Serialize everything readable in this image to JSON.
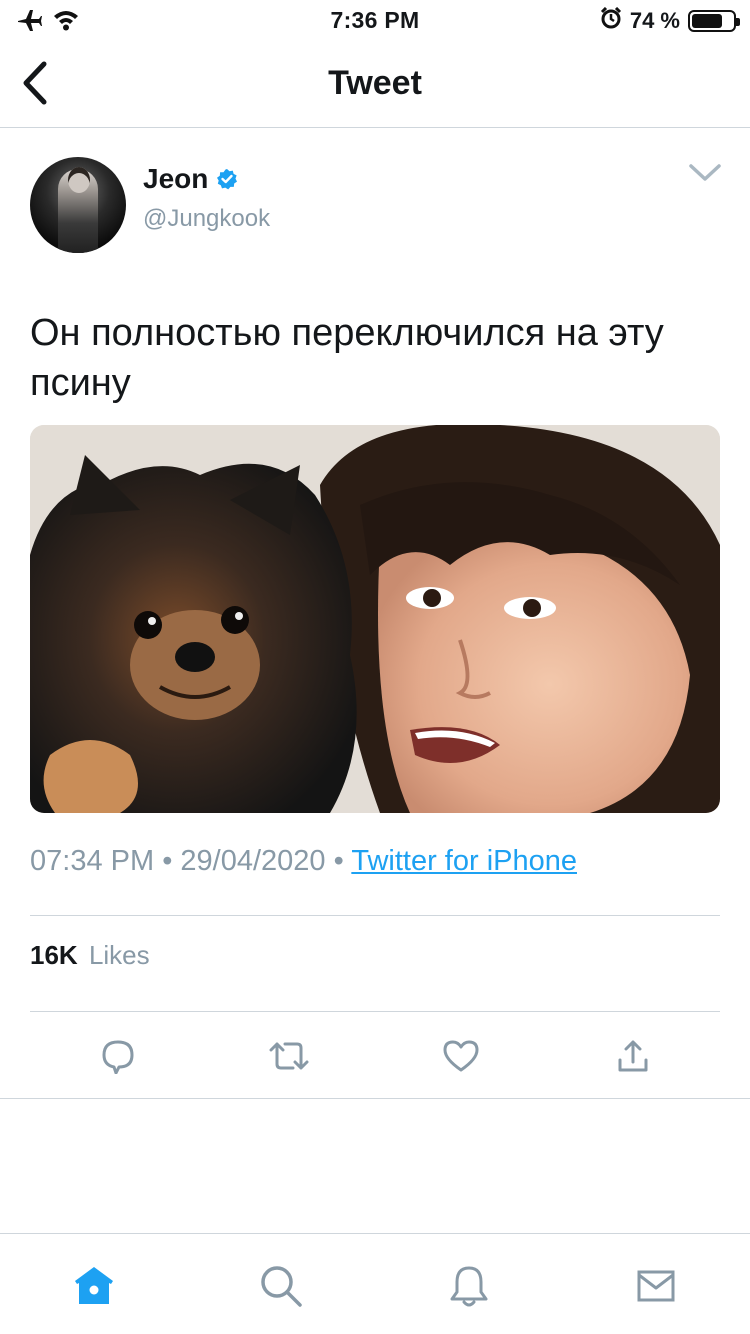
{
  "status_bar": {
    "time": "7:36 PM",
    "battery_percent": "74 %",
    "battery_level": 0.74,
    "icons": [
      "airplane-icon",
      "wifi-icon",
      "alarm-icon",
      "battery-icon"
    ]
  },
  "nav": {
    "title": "Tweet",
    "back_icon": "chevron-left-icon"
  },
  "tweet": {
    "author": {
      "name": "Jeon",
      "handle": "@Jungkook",
      "verified": true
    },
    "text": "Он полностью переключился на эту псину",
    "meta": {
      "time": "07:34 PM",
      "separator": "•",
      "date": "29/04/2020",
      "source": "Twitter for iPhone"
    },
    "likes": {
      "count": "16K",
      "label": "Likes"
    }
  },
  "actions": [
    "reply-icon",
    "retweet-icon",
    "like-icon",
    "share-icon"
  ],
  "tab_bar": {
    "items": [
      "home-icon",
      "search-icon",
      "notifications-icon",
      "messages-icon"
    ],
    "active": "home-icon"
  },
  "colors": {
    "accent": "#1da1f2",
    "secondary_text": "#8899a6",
    "divider": "#cfd6dc",
    "primary_text": "#14171a"
  }
}
